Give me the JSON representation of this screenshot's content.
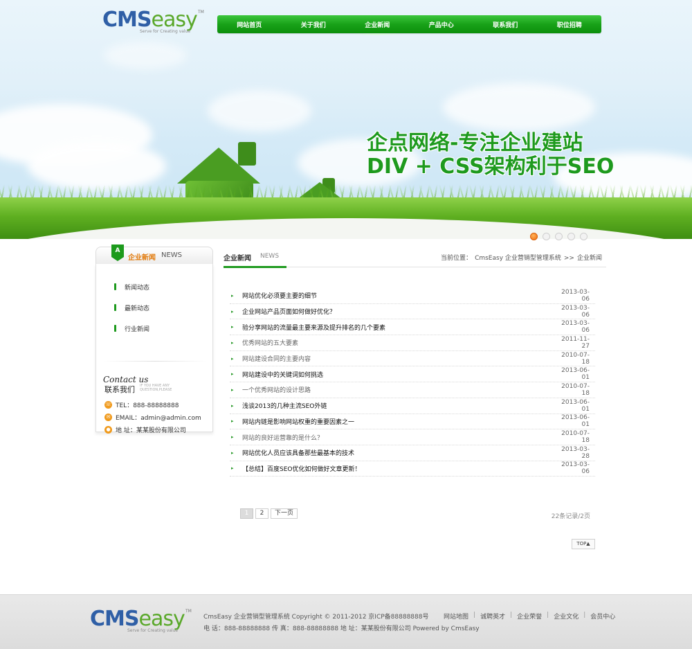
{
  "header": {
    "logo": {
      "brand_main": "CMS",
      "brand_sub": "easy",
      "tm": "TM",
      "tagline": "Serve for Creating value"
    },
    "nav": [
      {
        "label": "网站首页"
      },
      {
        "label": "关于我们"
      },
      {
        "label": "企业新闻",
        "active": true
      },
      {
        "label": "产品中心"
      },
      {
        "label": "联系我们"
      },
      {
        "label": "职位招聘"
      }
    ]
  },
  "banner": {
    "slogan_line1": "企点网络-专注企业建站",
    "slogan_line2": "DIV + CSS架构利于SEO",
    "slide_count": 5,
    "active_slide": 1
  },
  "sidebar": {
    "badge": "A",
    "title": "企业新闻",
    "title_en": "NEWS",
    "menu": [
      {
        "label": "新闻动态"
      },
      {
        "label": "最新动态"
      },
      {
        "label": "行业新闻"
      }
    ],
    "contact": {
      "heading_en": "Contact us",
      "heading_cn": "联系我们",
      "sub_en": "IF YOU HAVE ANY QUESTION,PLEASE",
      "tel": "TEL：888-88888888",
      "email": "EMAIL：admin@admin.com",
      "address": "地 址：某某股份有限公司"
    }
  },
  "main": {
    "title": "企业新闻",
    "title_en": "NEWS",
    "breadcrumb": {
      "prefix": "当前位置：",
      "site": "CmsEasy 企业营销型管理系统",
      "separator": ">>",
      "current": "企业新闻"
    },
    "news": [
      {
        "title": "网站优化必须要主要的细节",
        "date": "2013-03-06",
        "style": "dark"
      },
      {
        "title": "企业网站产品页面如何做好优化？",
        "date": "2013-03-06",
        "style": "dark"
      },
      {
        "title": "验分享网站的流量最主要来源及提升排名的几个要素",
        "date": "2013-03-06",
        "style": "dark"
      },
      {
        "title": "优秀网站的五大要素",
        "date": "2011-11-27",
        "style": "gray"
      },
      {
        "title": "网站建设合同的主要内容",
        "date": "2010-07-18",
        "style": "gray"
      },
      {
        "title": "网站建设中的关键词如何挑选",
        "date": "2013-06-01",
        "style": "dark"
      },
      {
        "title": "一个优秀网站的设计思路",
        "date": "2010-07-18",
        "style": "gray"
      },
      {
        "title": "浅谈2013的几种主流SEO外链",
        "date": "2013-06-01",
        "style": "dark"
      },
      {
        "title": "网站内链是影响网站权重的重要因素之一",
        "date": "2013-06-01",
        "style": "dark"
      },
      {
        "title": "网站的良好运营靠的是什么？",
        "date": "2010-07-18",
        "style": "gray"
      },
      {
        "title": "网站优化人员应该具备那些最基本的技术",
        "date": "2013-03-28",
        "style": "dark"
      },
      {
        "title": "【总结】百度SEO优化如何做好文章更新！",
        "date": "2013-03-06",
        "style": "dark"
      }
    ],
    "pager": {
      "pages": [
        "1",
        "2"
      ],
      "current": "1",
      "next": "下一页",
      "summary": "22条记录/2页"
    },
    "top_button": "TOP▲"
  },
  "footer": {
    "line1": "CmsEasy 企业营销型管理系统  Copyright © 2011-2012  京ICP备88888888号",
    "line2": "电 话：888-88888888  传 真：888-88888888  地 址：某某股份有限公司  Powered by CmsEasy",
    "links": [
      {
        "label": "网站地图"
      },
      {
        "label": "诚聘英才"
      },
      {
        "label": "企业荣誉"
      },
      {
        "label": "企业文化"
      },
      {
        "label": "会员中心"
      }
    ]
  },
  "colors": {
    "brand_green": "#1e9a1e",
    "logo_blue": "#2f5fa6",
    "accent_orange": "#e27b0d"
  }
}
